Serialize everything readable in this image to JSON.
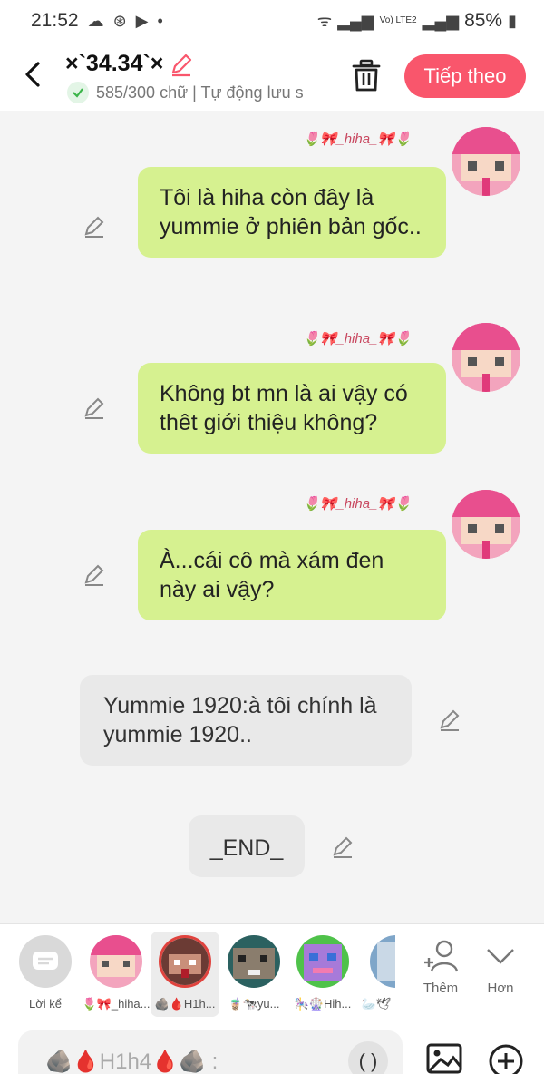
{
  "status": {
    "time": "21:52",
    "battery": "85%",
    "network": "Vo) LTE2"
  },
  "header": {
    "title": "×`34.34`×",
    "subtitle": "585/300 chữ | Tự động lưu s",
    "next_label": "Tiếp theo"
  },
  "messages": [
    {
      "side": "right",
      "nickname": "🌷🎀_hiha_🎀🌷",
      "text": "Tôi là hiha còn đây là yummie ở phiên bản gốc.."
    },
    {
      "side": "right",
      "nickname": "🌷🎀_hiha_🎀🌷",
      "text": "Không bt mn là ai vậy có thêt giới thiệu không?"
    },
    {
      "side": "right",
      "nickname": "🌷🎀_hiha_🎀🌷",
      "text": "À...cái cô mà xám đen này ai vậy?"
    },
    {
      "side": "left",
      "text": "Yummie 1920:à tôi chính là yummie 1920.."
    },
    {
      "side": "center",
      "text": "_END_"
    }
  ],
  "characters": [
    {
      "label": "Lời kể",
      "type": "narrator"
    },
    {
      "label": "🌷🎀_hiha...",
      "type": "pink"
    },
    {
      "label": "🪨🩸H1h...",
      "type": "dark",
      "selected": true
    },
    {
      "label": "🧋🐄yu...",
      "type": "cow"
    },
    {
      "label": "🎠🎡Hih...",
      "type": "purple"
    },
    {
      "label": "🦢🕊",
      "type": "blue"
    }
  ],
  "tools": {
    "add_label": "Thêm",
    "more_label": "Hơn"
  },
  "input": {
    "placeholder": "🪨🩸H1h4🩸🪨 :",
    "paren_label": "( )"
  },
  "colors": {
    "accent": "#f9566c",
    "bubble_green": "#d6f190",
    "bubble_gray": "#e9e9e9"
  }
}
